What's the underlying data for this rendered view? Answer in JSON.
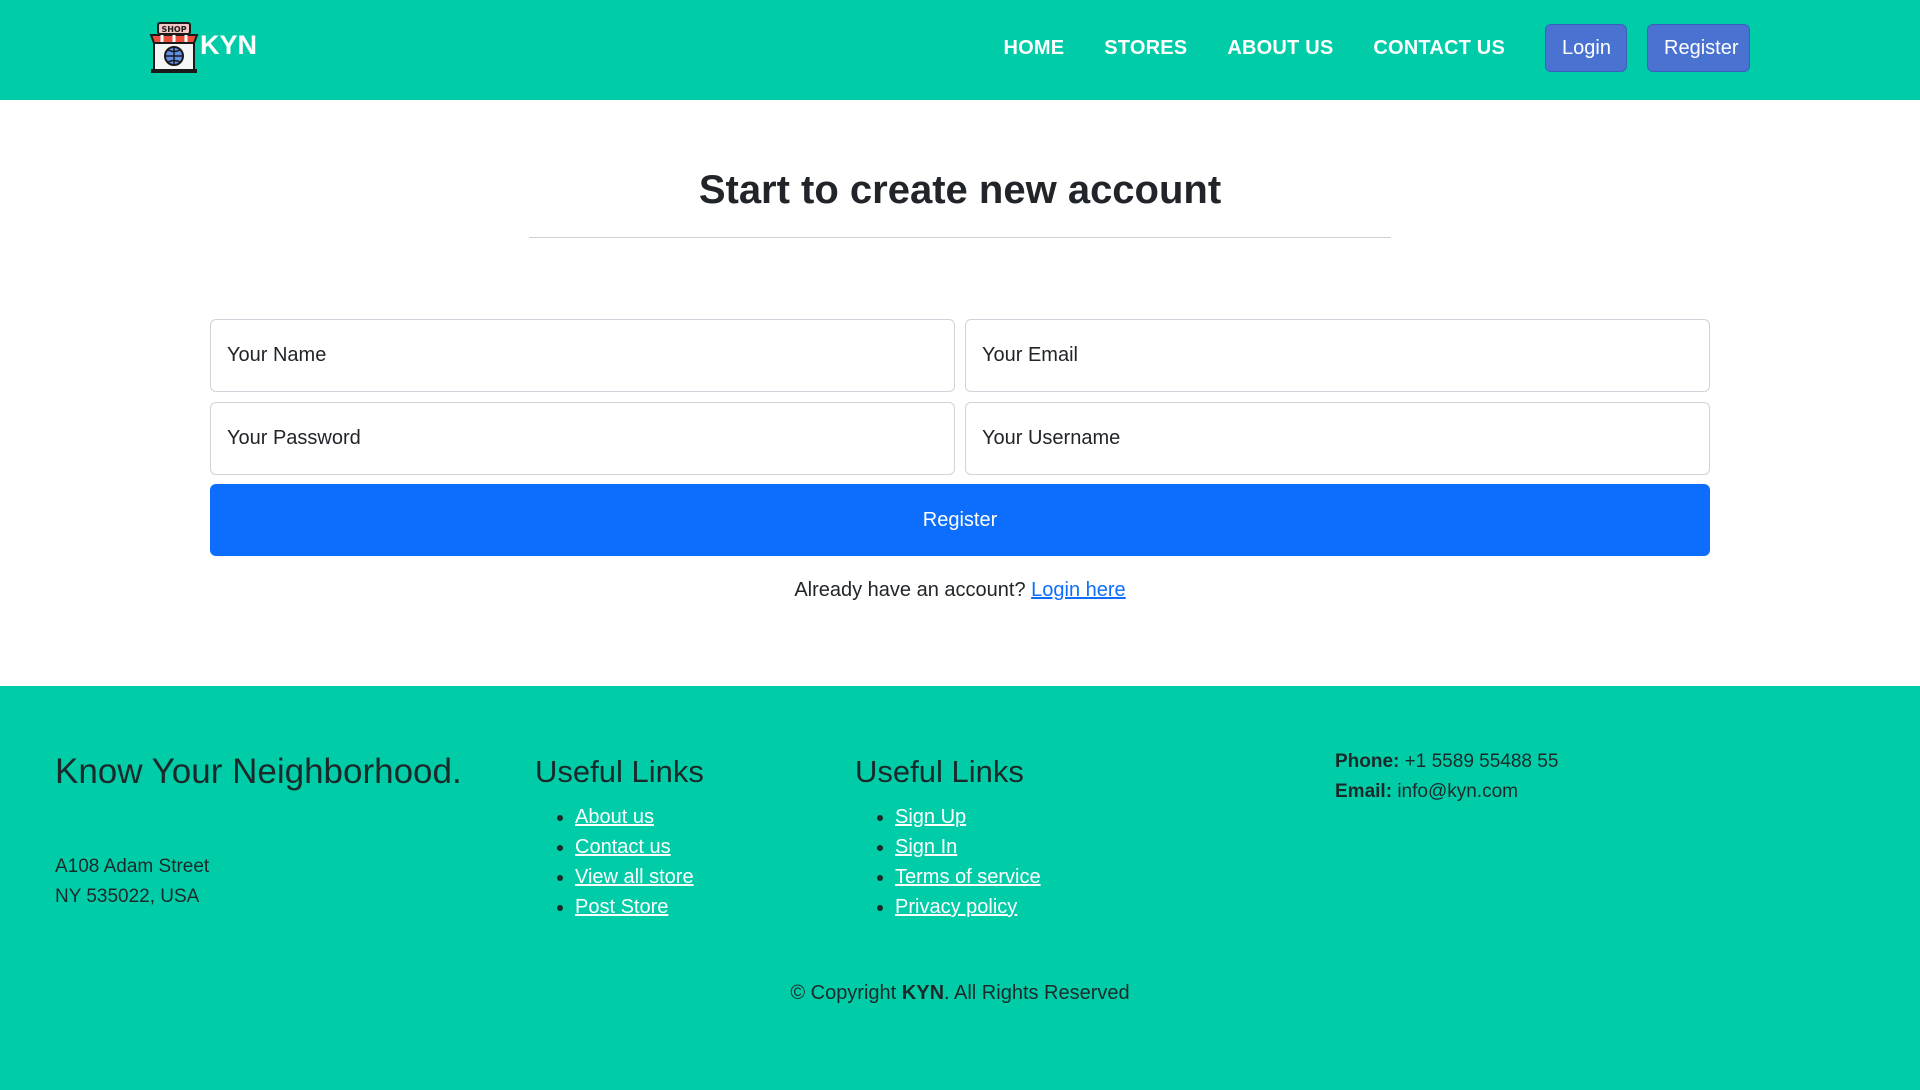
{
  "navbar": {
    "brand": "KYN",
    "logo_text": "SHOP",
    "links": [
      "HOME",
      "STORES",
      "ABOUT US",
      "CONTACT US"
    ],
    "login_label": "Login",
    "register_label": "Register",
    "color": "#00cda8",
    "button_color": "#4a72d1"
  },
  "main": {
    "title": "Start to create new account",
    "fields": {
      "name_placeholder": "Your Name",
      "email_placeholder": "Your Email",
      "password_placeholder": "Your Password",
      "username_placeholder": "Your Username"
    },
    "submit_label": "Register",
    "login_prompt": "Already have an account?",
    "login_link": "Login here",
    "submit_color": "#0d6efd"
  },
  "footer": {
    "title": "Know Your Neighborhood.",
    "address_line1": "A108 Adam Street",
    "address_line2": "NY 535022, USA",
    "col1": {
      "heading": "Useful Links",
      "links": [
        "About us",
        "Contact us",
        "View all store",
        "Post Store"
      ]
    },
    "col2": {
      "heading": "Useful Links",
      "links": [
        "Sign Up",
        "Sign In",
        "Terms of service",
        "Privacy policy"
      ]
    },
    "phone_label": "Phone:",
    "phone": "+1 5589 55488 55",
    "email_label": "Email:",
    "email": "info@kyn.com",
    "copyright_prefix": "© Copyright",
    "copyright_brand": "KYN",
    "copyright_suffix": ". All Rights Reserved"
  }
}
